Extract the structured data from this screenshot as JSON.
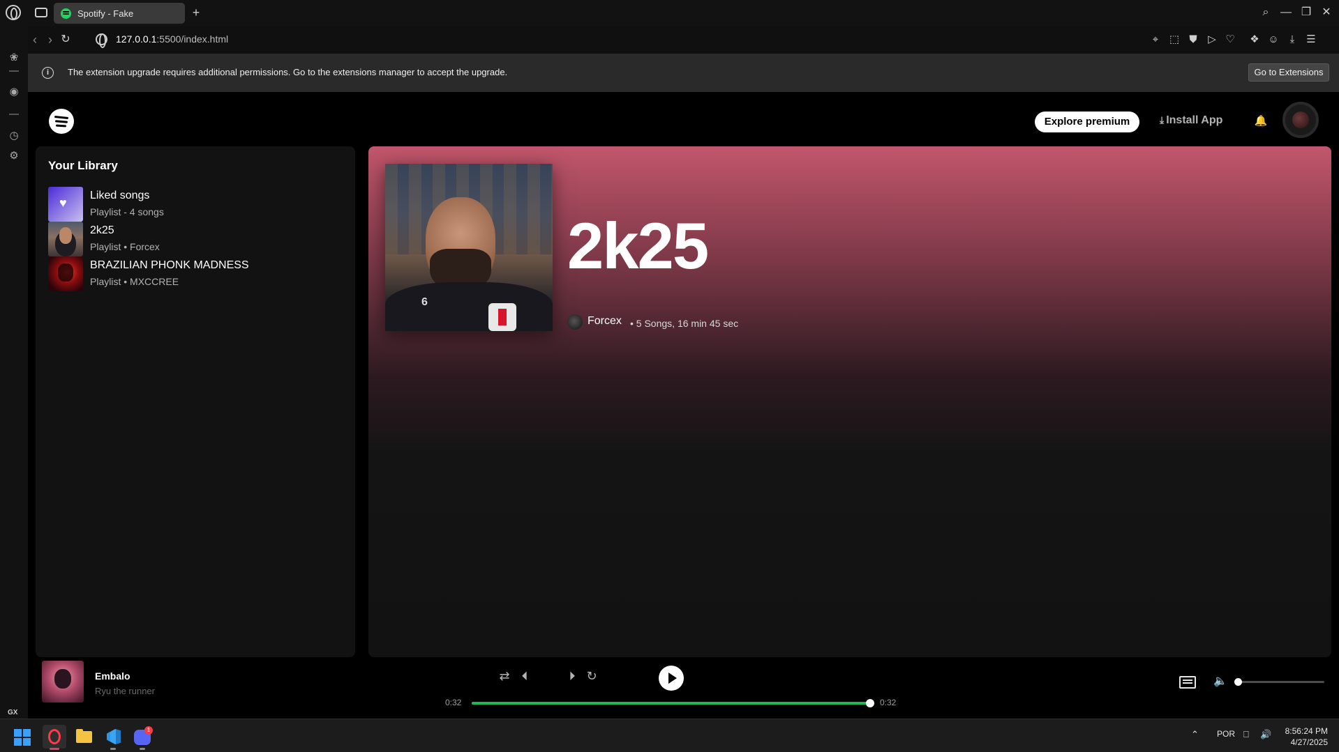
{
  "browser": {
    "tab_title": "Spotify - Fake",
    "url_host": "127.0.0.1",
    "url_path": ":5500/index.html",
    "infobar_message": "The extension upgrade requires additional permissions. Go to the extensions manager to accept the upgrade.",
    "infobar_button": "Go to Extensions",
    "sidebar_gx_label": "GX",
    "new_tab_glyph": "+"
  },
  "header": {
    "explore_premium": "Explore premium",
    "install_app": "Install App"
  },
  "library": {
    "title": "Your Library",
    "items": [
      {
        "name": "Liked songs",
        "subtitle": "Playlist - 4 songs"
      },
      {
        "name": "2k25",
        "subtitle": "Playlist • Forcex"
      },
      {
        "name": "BRAZILIAN PHONK MADNESS",
        "subtitle": "Playlist • MXCCREE"
      }
    ]
  },
  "playlist": {
    "title": "2k25",
    "owner": "Forcex",
    "meta": "• 5 Songs, 16 min 45 sec",
    "cover_jersey_number": "6"
  },
  "player": {
    "track_title": "Embalo",
    "track_artist": "Ryu the runner",
    "time_current": "0:32",
    "time_total": "0:32",
    "progress_fraction": 1.0,
    "volume_fraction": 0.0
  },
  "taskbar": {
    "language": "POR",
    "time": "8:56:24 PM",
    "date": "4/27/2025",
    "discord_badge": "1"
  },
  "colors": {
    "spotify_green": "#1db954",
    "header_gradient_top": "#c2566c",
    "background": "#121212"
  }
}
